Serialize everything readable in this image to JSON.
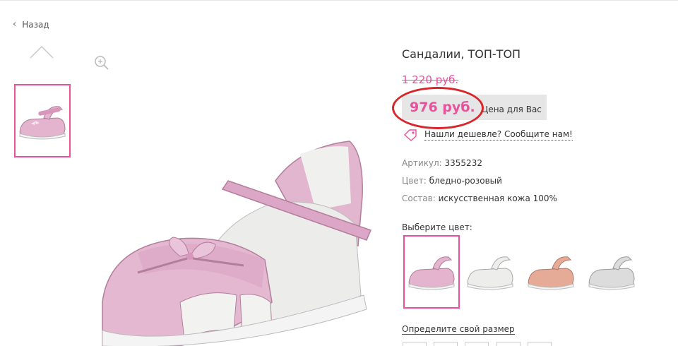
{
  "nav": {
    "back_label": "Назад"
  },
  "product": {
    "title": "Сандалии, ТОП-ТОП",
    "old_price": "1 220 руб.",
    "new_price": "976 руб.",
    "price_label": "Цена для Вас",
    "cheaper_text": "Нашли дешевле? Сообщите нам!",
    "specs": [
      {
        "key": "Артикул:",
        "value": "3355232"
      },
      {
        "key": "Цвет:",
        "value": "бледно-розовый"
      },
      {
        "key": "Состав:",
        "value": "искусственная кожа 100%"
      }
    ]
  },
  "colors": {
    "title": "Выберите цвет:",
    "options": [
      {
        "name": "pink",
        "color": "#e4b4cf",
        "selected": true
      },
      {
        "name": "white",
        "color": "#e8e8e6",
        "selected": false
      },
      {
        "name": "peach",
        "color": "#e6ab96",
        "selected": false
      },
      {
        "name": "grey",
        "color": "#d8d8d8",
        "selected": false
      }
    ]
  },
  "size": {
    "link_label": "Определите свой размер"
  },
  "theme": {
    "accent": "#e8529c",
    "highlight": "#d8262a"
  }
}
